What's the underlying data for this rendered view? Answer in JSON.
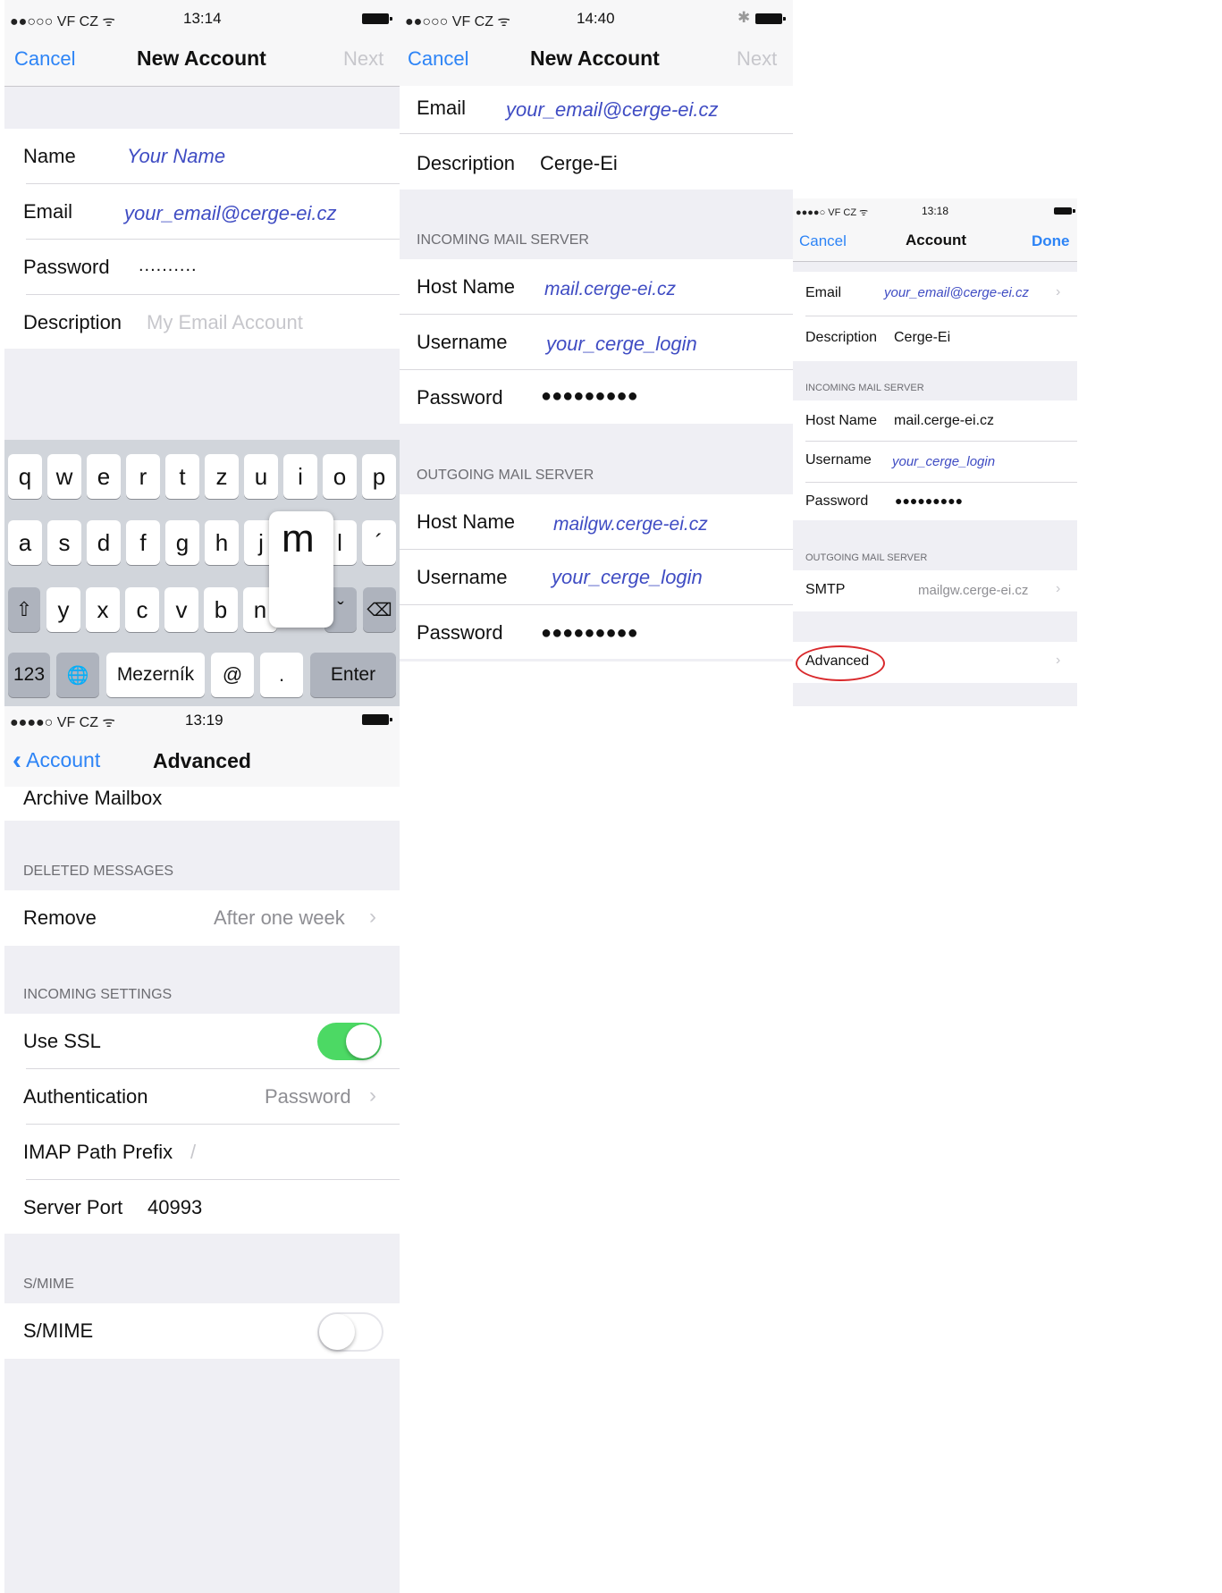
{
  "panel1": {
    "status": {
      "carrier": "●●○○○ VF CZ ᯤ",
      "time": "13:14"
    },
    "nav": {
      "cancel": "Cancel",
      "title": "New Account",
      "next": "Next"
    },
    "fields": {
      "name_label": "Name",
      "name_value": "Your Name",
      "email_label": "Email",
      "email_value": "your_email@cerge-ei.cz",
      "password_label": "Password",
      "password_value": "..........",
      "description_label": "Description",
      "description_placeholder": "My Email Account"
    },
    "keyboard": {
      "row1": [
        "q",
        "w",
        "e",
        "r",
        "t",
        "z",
        "u",
        "i",
        "o",
        "p"
      ],
      "row2": [
        "a",
        "s",
        "d",
        "f",
        "g",
        "h",
        "j",
        "l",
        "´"
      ],
      "popup": "m",
      "row3": [
        "y",
        "x",
        "c",
        "v",
        "b",
        "n"
      ],
      "shift": "⇧",
      "hacek": "ˇ",
      "backspace": "⌫",
      "numbers": "123",
      "globe": "🌐",
      "space": "Mezerník",
      "at": "@",
      "dot": ".",
      "enter": "Enter"
    }
  },
  "panel2": {
    "status": {
      "carrier": "●●○○○ VF CZ ᯤ",
      "time": "14:40",
      "bluetooth": "✱"
    },
    "nav": {
      "cancel": "Cancel",
      "title": "New Account",
      "next": "Next"
    },
    "email_label": "Email",
    "email_value": "your_email@cerge-ei.cz",
    "description_label": "Description",
    "description_value": "Cerge-Ei",
    "incoming_header": "INCOMING MAIL SERVER",
    "incoming": {
      "host_label": "Host Name",
      "host_value": "mail.cerge-ei.cz",
      "user_label": "Username",
      "user_value": "your_cerge_login",
      "pass_label": "Password",
      "pass_value": "●●●●●●●●●"
    },
    "outgoing_header": "OUTGOING MAIL SERVER",
    "outgoing": {
      "host_label": "Host Name",
      "host_value": "mailgw.cerge-ei.cz",
      "user_label": "Username",
      "user_value": "your_cerge_login",
      "pass_label": "Password",
      "pass_value": "●●●●●●●●●"
    }
  },
  "panel3": {
    "status": {
      "carrier": "●●●●○ VF CZ ᯤ",
      "time": "13:18"
    },
    "nav": {
      "cancel": "Cancel",
      "title": "Account",
      "done": "Done"
    },
    "email_label": "Email",
    "email_value": "your_email@cerge-ei.cz",
    "description_label": "Description",
    "description_value": "Cerge-Ei",
    "incoming_header": "INCOMING MAIL SERVER",
    "host_label": "Host Name",
    "host_value": "mail.cerge-ei.cz",
    "user_label": "Username",
    "user_value": "your_cerge_login",
    "pass_label": "Password",
    "pass_value": "●●●●●●●●●",
    "outgoing_header": "OUTGOING MAIL SERVER",
    "smtp_label": "SMTP",
    "smtp_value": "mailgw.cerge-ei.cz",
    "advanced_label": "Advanced",
    "highlight_color": "#d9292c"
  },
  "panel4": {
    "status": {
      "carrier": "●●●●○ VF CZ ᯤ",
      "time": "13:19"
    },
    "nav": {
      "back": "Account",
      "title": "Advanced"
    },
    "archive_label": "Archive Mailbox",
    "deleted_header": "DELETED MESSAGES",
    "remove_label": "Remove",
    "remove_value": "After one week",
    "incoming_header": "INCOMING SETTINGS",
    "ssl_label": "Use SSL",
    "ssl_on": true,
    "auth_label": "Authentication",
    "auth_value": "Password",
    "imap_label": "IMAP Path Prefix",
    "imap_value": "/",
    "port_label": "Server Port",
    "port_value": "40993",
    "smime_header": "S/MIME",
    "smime_label": "S/MIME",
    "smime_on": false,
    "toggle_on_color": "#4cd964"
  },
  "colors": {
    "ios_blue": "#2d84f6",
    "entry_blue": "#3f4cc3",
    "group_bg": "#efeff4"
  }
}
